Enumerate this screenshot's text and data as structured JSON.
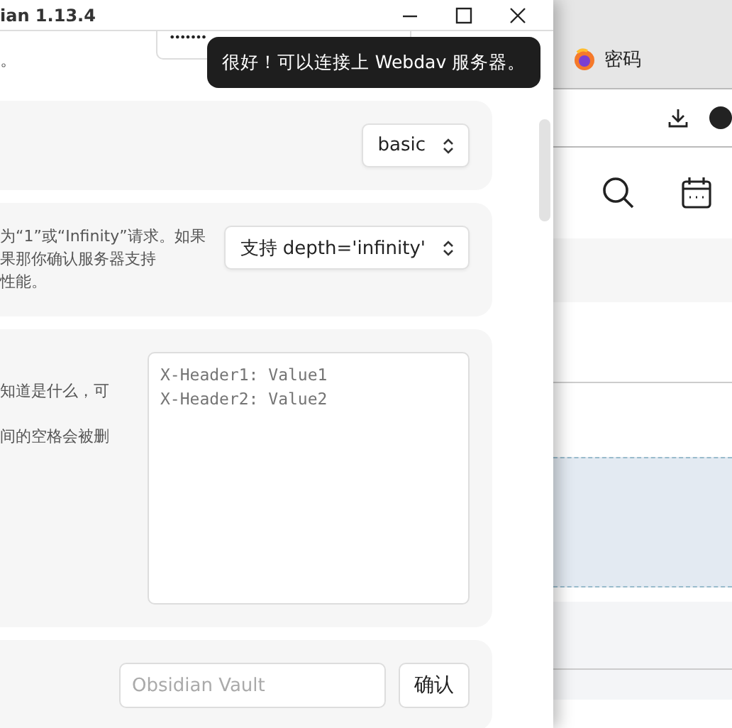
{
  "window": {
    "title": "ian 1.13.4"
  },
  "password_row": {
    "description": "。",
    "value": "•••••••"
  },
  "settings": [
    {
      "kind": "select",
      "value": "basic"
    },
    {
      "kind": "select",
      "description": [
        "为“1”或“Infinity”请求。如果",
        "果那你确认服务器支持",
        "性能。"
      ],
      "value": "支持 depth='infinity'"
    },
    {
      "kind": "textarea",
      "description": [
        "知道是什么，可",
        "间的空格会被删"
      ],
      "placeholder": "X-Header1: Value1\nX-Header2: Value2"
    },
    {
      "kind": "input",
      "placeholder": "Obsidian Vault",
      "button": "确认"
    }
  ],
  "toast": {
    "text": "很好！可以连接上 Webdav 服务器。"
  },
  "browser": {
    "tab": {
      "title": "密码"
    }
  }
}
